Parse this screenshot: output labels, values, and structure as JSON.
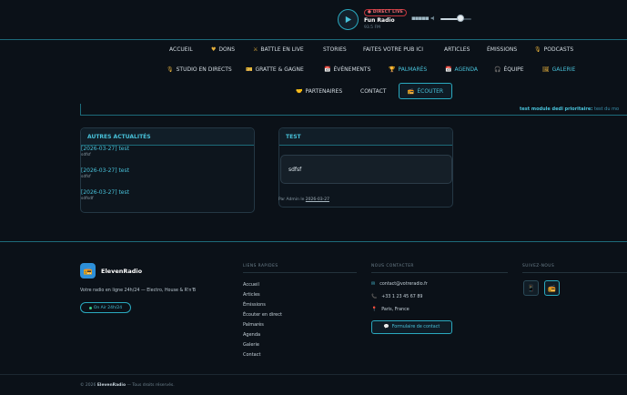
{
  "player": {
    "live_badge": "● DIRECT LIVE",
    "station": "Fun Radio",
    "frequency": "93.5 FM",
    "volume_level": 0.66
  },
  "nav": {
    "row1": [
      {
        "label": "ACCUEIL",
        "icon": ""
      },
      {
        "label": "DONS",
        "icon": "heart-icon"
      },
      {
        "label": "BATTLE EN LIVE",
        "icon": "swords-icon"
      },
      {
        "label": "STORIES",
        "icon": ""
      },
      {
        "label": "FAITES VOTRE PUB ICI",
        "icon": ""
      },
      {
        "label": "ARTICLES",
        "icon": ""
      },
      {
        "label": "ÉMISSIONS",
        "icon": ""
      },
      {
        "label": "PODCASTS",
        "icon": "mic-icon"
      }
    ],
    "row2": [
      {
        "label": "STUDIO EN DIRECTS",
        "icon": "mic-icon"
      },
      {
        "label": "GRATTE & GAGNE",
        "icon": "ticket-icon"
      },
      {
        "label": "ÉVÉNEMENTS",
        "icon": "calendar-icon"
      },
      {
        "label": "PALMARÈS",
        "icon": "trophy-icon"
      },
      {
        "label": "AGENDA",
        "icon": "calendar-icon"
      },
      {
        "label": "ÉQUIPE",
        "icon": "headphones-icon"
      },
      {
        "label": "GALERIE",
        "icon": "image-icon"
      }
    ],
    "row3": [
      {
        "label": "PARTENAIRES",
        "icon": "handshake-icon"
      },
      {
        "label": "CONTACT",
        "icon": ""
      }
    ],
    "listen_label": "ÉCOUTER"
  },
  "ticker": {
    "title": "test module dedi prioritaire:",
    "text": "test du mo"
  },
  "news_panel": {
    "title": "AUTRES ACTUALITÉS",
    "items": [
      {
        "title": "[2026-03-27] test",
        "sub": "sdfsf"
      },
      {
        "title": "[2026-03-27] test",
        "sub": "sdfsf"
      },
      {
        "title": "[2026-03-27] test",
        "sub": "sdfsdf"
      }
    ]
  },
  "test_panel": {
    "title": "TEST",
    "body": "sdfsf",
    "byline_prefix": "Par Admin le",
    "byline_date": "2026-03-27"
  },
  "footer": {
    "brand": "ElevenRadio",
    "description": "Votre radio en ligne 24h/24 — Electro, House & R'n'B",
    "onair": "On Air 24h/24",
    "quick_links_title": "LIENS RAPIDES",
    "quick_links": [
      "Accueil",
      "Articles",
      "Émissions",
      "Écouter en direct",
      "Palmarès",
      "Agenda",
      "Galerie",
      "Contact"
    ],
    "contact_title": "NOUS CONTACTER",
    "email": "contact@votreradio.fr",
    "phone": "+33 1 23 45 67 89",
    "location": "Paris, France",
    "contact_form": "Formulaire de contact",
    "follow_title": "SUIVEZ-NOUS",
    "copyright_prefix": "© 2026",
    "copyright_brand": "ElevenRadio",
    "copyright_suffix": "— Tous droits réservés."
  },
  "colors": {
    "accent": "#48c2da",
    "background": "#0b1118",
    "live": "#f06a70",
    "gold": "#e7b13c"
  }
}
